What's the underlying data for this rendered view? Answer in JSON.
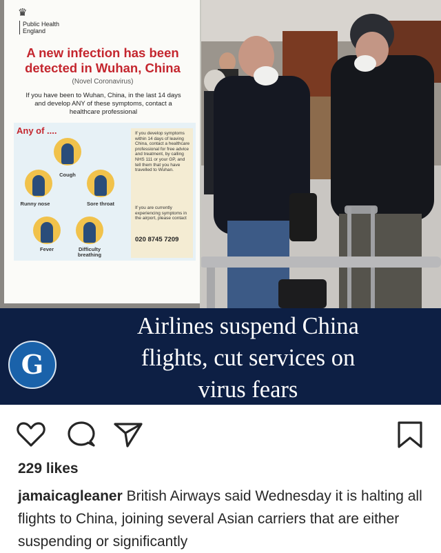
{
  "post_image": {
    "poster": {
      "org_lines": [
        "Public Health",
        "England"
      ],
      "headline": "A new infection has been detected in Wuhan, China",
      "subheadline": "(Novel Coronavirus)",
      "intro": "If you have been to Wuhan, China, in the last 14 days and develop ANY of these symptoms, contact a healthcare professional",
      "any_of": "Any of ....",
      "symptoms": [
        "Cough",
        "Runny nose",
        "Sore throat",
        "Fever",
        "Difficulty breathing"
      ],
      "advice_1": "If you develop symptoms within 14 days of leaving China, contact a healthcare professional for free advice and treatment, by calling NHS 111 or your GP, and tell them that you have travelled to Wuhan.",
      "advice_2": "If you are currently experiencing symptoms in the airport, please contact",
      "phone": "020 8745 7209"
    },
    "banner": {
      "logo_letter": "G",
      "title_lines": [
        "Airlines suspend China",
        "flights, cut services on",
        "virus fears"
      ]
    }
  },
  "actions": {
    "like_icon": "heart-icon",
    "comment_icon": "comment-icon",
    "share_icon": "paper-plane-icon",
    "save_icon": "bookmark-icon"
  },
  "likes": "229 likes",
  "caption": {
    "username": "jamaicagleaner",
    "text": "British Airways said Wednesday it is halting all flights to China, joining several Asian carriers that are either suspending or significantly"
  },
  "colors": {
    "poster_red": "#c4262e",
    "banner_navy": "#0d1f44",
    "logo_blue": "#1a62aa",
    "symptom_yellow": "#f1c24b"
  }
}
